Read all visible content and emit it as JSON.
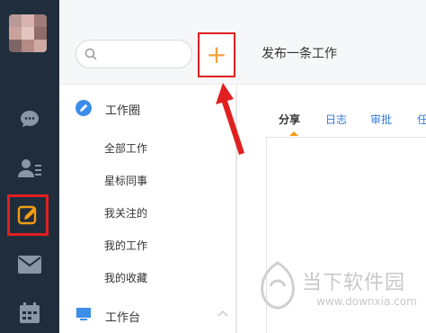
{
  "colors": {
    "rail_bg": "#1f2d3d",
    "accent_orange": "#f39c12",
    "highlight_red": "#e02020",
    "link_blue": "#2f7bd6"
  },
  "rail": {
    "avatar": "avatar",
    "icons": [
      {
        "name": "chat-icon"
      },
      {
        "name": "contacts-icon"
      },
      {
        "name": "edit-post-icon",
        "selected": true
      },
      {
        "name": "mail-icon"
      },
      {
        "name": "calendar-icon"
      }
    ]
  },
  "sidebar": {
    "search": {
      "placeholder": "",
      "value": ""
    },
    "add_button_label": "+",
    "sections": [
      {
        "label": "工作圈",
        "icon": "pencil-circle-icon"
      },
      {
        "label": "工作台",
        "icon": "monitor-icon"
      }
    ],
    "items": [
      "全部工作",
      "星标同事",
      "我关注的",
      "我的工作",
      "我的收藏"
    ]
  },
  "main": {
    "title": "发布一条工作",
    "tabs": [
      {
        "label": "分享",
        "active": true
      },
      {
        "label": "日志"
      },
      {
        "label": "审批"
      },
      {
        "label": "任"
      }
    ]
  },
  "watermark": {
    "brand": "当下软件园",
    "url": "www.downxia.com"
  }
}
